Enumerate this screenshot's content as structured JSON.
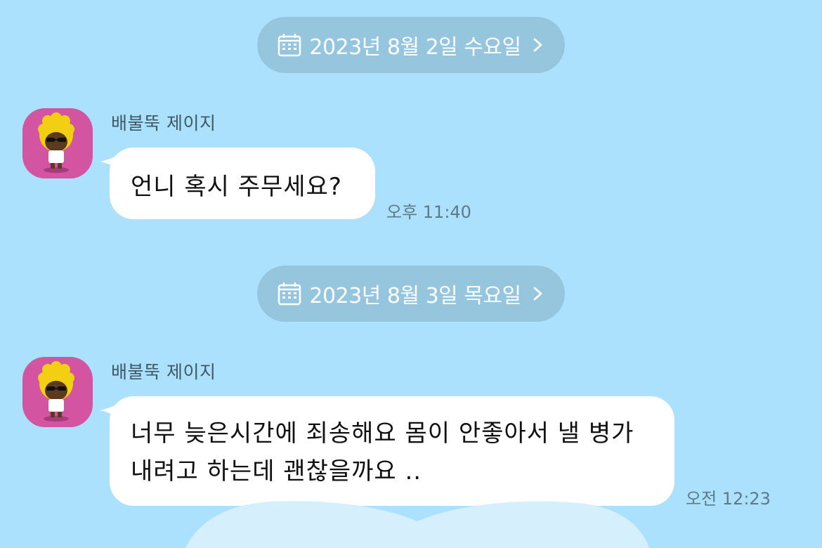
{
  "colors": {
    "background": "#abe1fd",
    "date_pill": "#95c6de",
    "avatar_bg": "#d354a0",
    "bubble": "#ffffff"
  },
  "date_separators": [
    {
      "label": "2023년 8월 2일 수요일",
      "icon": "calendar-icon",
      "chevron": "chevron-right-icon"
    },
    {
      "label": "2023년 8월 3일 목요일",
      "icon": "calendar-icon",
      "chevron": "chevron-right-icon"
    }
  ],
  "messages": [
    {
      "sender": "배불뚝 제이지",
      "avatar": "jay-g-character-avatar",
      "lines": [
        "언니 혹시 주무세요?"
      ],
      "time": "오후 11:40"
    },
    {
      "sender": "배불뚝 제이지",
      "avatar": "jay-g-character-avatar",
      "lines": [
        "너무 늦은시간에 죄송해요 몸이 안좋아서 낼 병가",
        "내려고 하는데 괜찮을까요 .."
      ],
      "time": "오전 12:23"
    }
  ]
}
